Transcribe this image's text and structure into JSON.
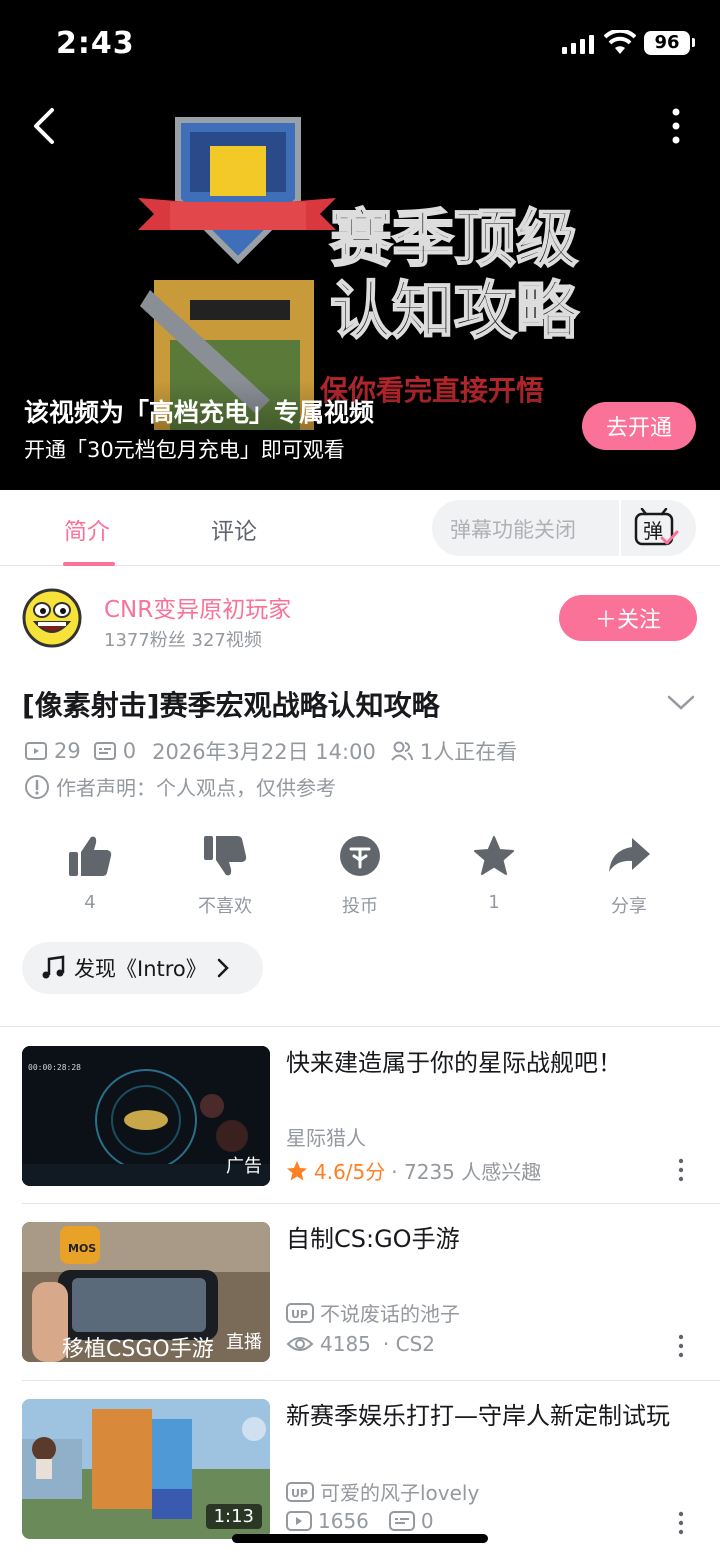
{
  "status_bar": {
    "time": "2:43",
    "battery": "96"
  },
  "player": {
    "cover_title_line1": "赛季顶级",
    "cover_title_line2": "认知攻略",
    "cover_subtitle": "保你看完直接开悟",
    "lock_line1": "该视频为「高档充电」专属视频",
    "lock_line2": "开通「30元档包月充电」即可观看",
    "open_button": "去开通"
  },
  "tabs": [
    {
      "label": "简介"
    },
    {
      "label": "评论"
    }
  ],
  "danmu": {
    "placeholder": "弹幕功能关闭",
    "icon_char": "弹"
  },
  "uploader": {
    "name": "CNR变异原初玩家",
    "stats": "1377粉丝  327视频",
    "follow_label": "＋关注"
  },
  "video": {
    "title": "[像素射击]赛季宏观战略认知攻略",
    "plays": "29",
    "danmaku": "0",
    "date": "2026年3月22日 14:00",
    "watching": "1人正在看",
    "declaration": "作者声明：个人观点，仅供参考"
  },
  "actions": [
    {
      "icon": "thumbs-up-icon",
      "label": "4"
    },
    {
      "icon": "thumbs-down-icon",
      "label": "不喜欢"
    },
    {
      "icon": "coin-icon",
      "label": "投币"
    },
    {
      "icon": "star-icon",
      "label": "1"
    },
    {
      "icon": "share-icon",
      "label": "分享"
    }
  ],
  "music": {
    "label": "发现《Intro》"
  },
  "recommendations": [
    {
      "title": "快来建造属于你的星际战舰吧！",
      "author": "星际猎人",
      "rating": "4.6/5分",
      "interest": "· 7235 人感兴趣",
      "badge": "广告",
      "thumb_time": "00:00:28:28"
    },
    {
      "title": "自制CS:GO手游",
      "author": "不说废话的池子",
      "views": "4185",
      "extra": "· CS2",
      "badge": "直播",
      "thumb_caption": "移植CSGO手游",
      "thumb_logo": "MOS"
    },
    {
      "title": "新赛季娱乐打打—守岸人新定制试玩",
      "author": "可爱的风子lovely",
      "views": "1656",
      "danmaku": "0",
      "duration": "1:13"
    }
  ],
  "colors": {
    "accent": "#fb7299",
    "rating": "#ff7f24",
    "muted": "#9499a0"
  }
}
